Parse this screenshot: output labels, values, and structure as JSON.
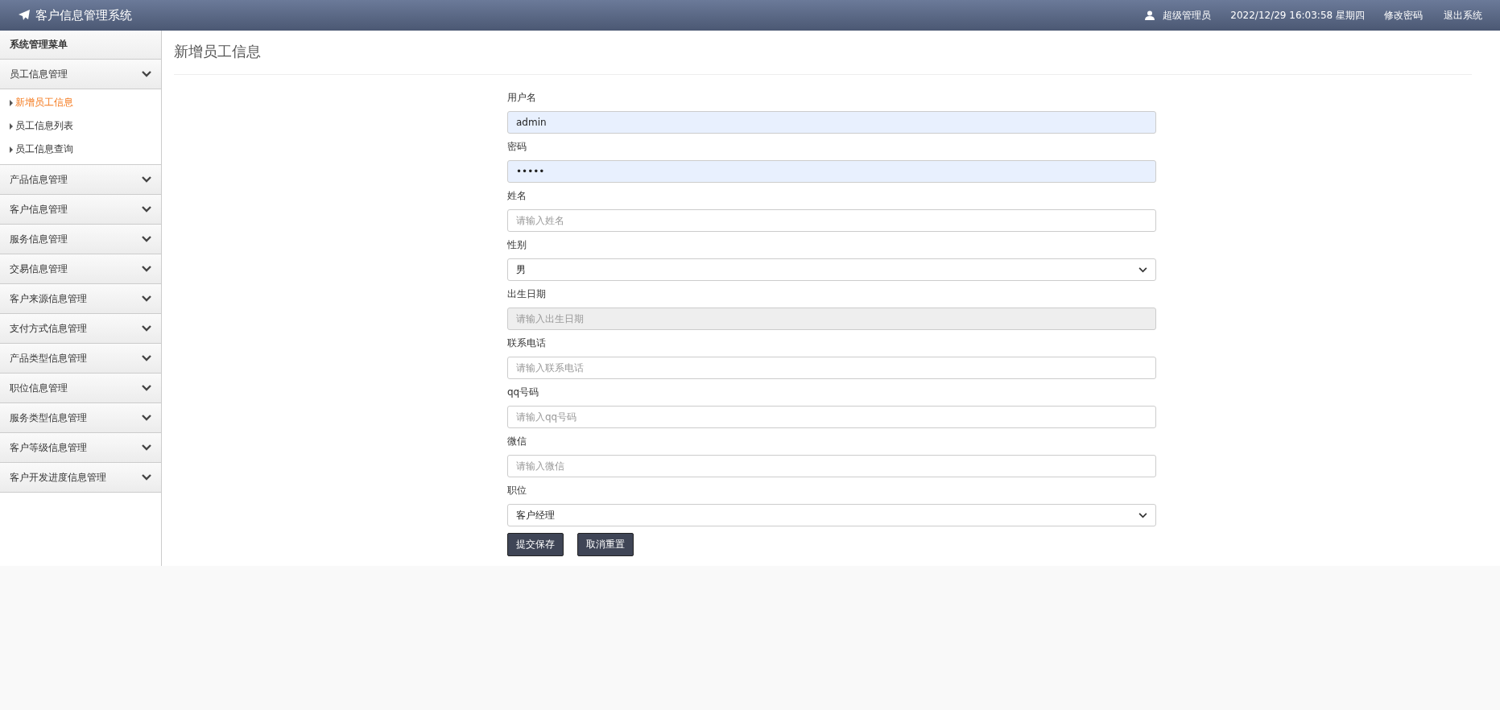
{
  "header": {
    "title": "客户信息管理系统",
    "user": "超级管理员",
    "datetime": "2022/12/29 16:03:58 星期四",
    "links": [
      "修改密码",
      "退出系统"
    ]
  },
  "sidebar": {
    "title": "系统管理菜单",
    "groups": [
      {
        "label": "员工信息管理",
        "children": [
          {
            "label": "新增员工信息",
            "selected": true
          },
          {
            "label": "员工信息列表",
            "selected": false
          },
          {
            "label": "员工信息查询",
            "selected": false
          }
        ]
      },
      {
        "label": "产品信息管理"
      },
      {
        "label": "客户信息管理"
      },
      {
        "label": "服务信息管理"
      },
      {
        "label": "交易信息管理"
      },
      {
        "label": "客户来源信息管理"
      },
      {
        "label": "支付方式信息管理"
      },
      {
        "label": "产品类型信息管理"
      },
      {
        "label": "职位信息管理"
      },
      {
        "label": "服务类型信息管理"
      },
      {
        "label": "客户等级信息管理"
      },
      {
        "label": "客户开发进度信息管理"
      }
    ]
  },
  "page": {
    "title": "新增员工信息"
  },
  "form": {
    "fields": [
      {
        "label": "用户名",
        "kind": "text",
        "value": "admin",
        "autofilled": true
      },
      {
        "label": "密码",
        "kind": "text",
        "value": "•••••",
        "autofilled": true
      },
      {
        "label": "姓名",
        "kind": "text",
        "placeholder": "请输入姓名",
        "autofilled": false
      },
      {
        "label": "性别",
        "kind": "select",
        "value": "男"
      },
      {
        "label": "出生日期",
        "kind": "date",
        "placeholder": "请输入出生日期"
      },
      {
        "label": "联系电话",
        "kind": "text",
        "placeholder": "请输入联系电话",
        "autofilled": false
      },
      {
        "label": "qq号码",
        "kind": "text",
        "placeholder": "请输入qq号码",
        "autofilled": false
      },
      {
        "label": "微信",
        "kind": "text",
        "placeholder": "请输入微信",
        "autofilled": false
      },
      {
        "label": "职位",
        "kind": "select",
        "value": "客户经理"
      }
    ],
    "buttons": [
      "提交保存",
      "取消重置"
    ]
  }
}
